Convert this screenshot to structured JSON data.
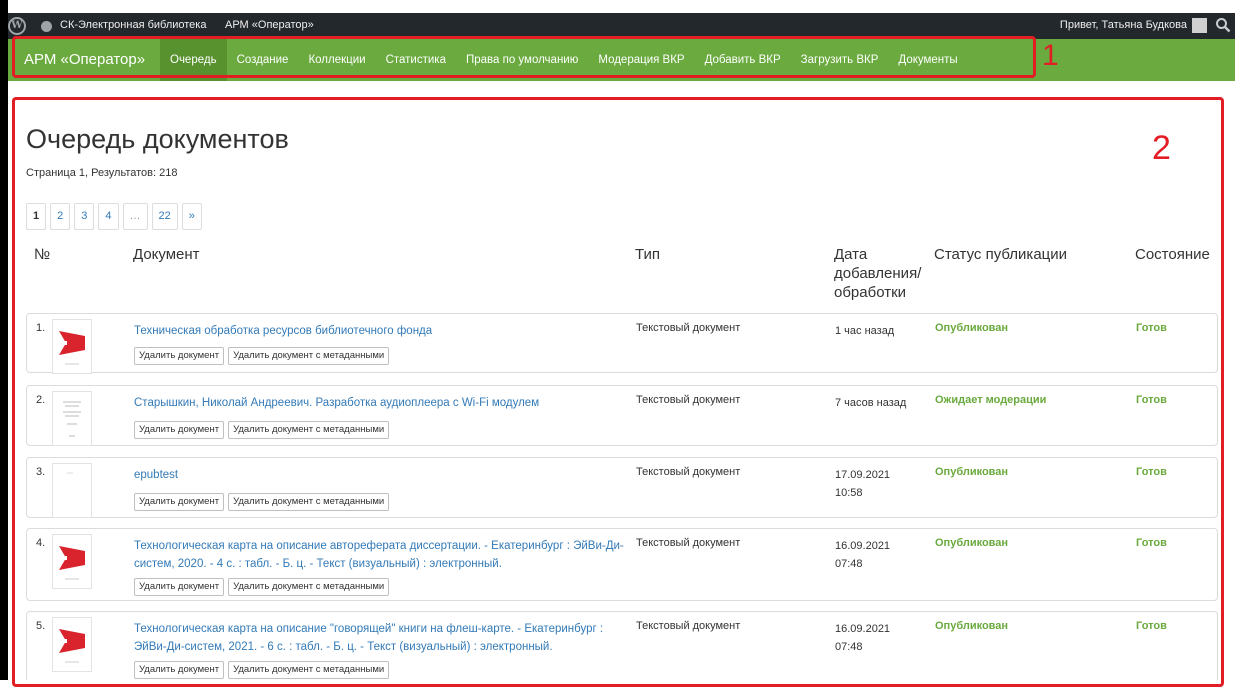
{
  "adminbar": {
    "site_name": "СК-Электронная библиотека",
    "arm_link": "АРМ «Оператор»",
    "greeting": "Привет, Татьяна Будкова"
  },
  "navbar": {
    "brand": "АРМ «Оператор»",
    "items": [
      {
        "label": "Очередь",
        "active": true
      },
      {
        "label": "Создание"
      },
      {
        "label": "Коллекции"
      },
      {
        "label": "Статистика"
      },
      {
        "label": "Права по умолчанию"
      },
      {
        "label": "Модерация ВКР"
      },
      {
        "label": "Добавить ВКР"
      },
      {
        "label": "Загрузить ВКР"
      },
      {
        "label": "Документы"
      }
    ]
  },
  "annotations": {
    "label1": "1",
    "label2": "2"
  },
  "page": {
    "title": "Очередь документов",
    "results": "Страница 1, Результатов: 218"
  },
  "pagination": {
    "pages": [
      "1",
      "2",
      "3",
      "4",
      "…",
      "22",
      "»"
    ],
    "current": "1"
  },
  "table": {
    "headers": {
      "num": "№",
      "document": "Документ",
      "type": "Тип",
      "date": "Дата добавления/ обработки",
      "status": "Статус публикации",
      "state": "Состояние"
    },
    "delete_label": "Удалить документ",
    "delete_meta_label": "Удалить документ с метаданными",
    "rows": [
      {
        "num": "1.",
        "title": "Техническая обработка ресурсов библиотечного фонда",
        "type": "Текстовый документ",
        "date": "1 час назад",
        "status": "Опубликован",
        "state": "Готов",
        "thumb": "red-cover"
      },
      {
        "num": "2.",
        "title": "Старышкин, Николай Андреевич. Разработка аудиоплеера с Wi-Fi модулем",
        "type": "Текстовый документ",
        "date": "7 часов назад",
        "status": "Ожидает модерации",
        "state": "Готов",
        "thumb": "text-page"
      },
      {
        "num": "3.",
        "title": "epubtest",
        "type": "Текстовый документ",
        "date": "17.09.2021 10:58",
        "status": "Опубликован",
        "state": "Готов",
        "thumb": "blank-page"
      },
      {
        "num": "4.",
        "title": "Технологическая карта на описание автореферата диссертации. - Екатеринбург : ЭйВи-Ди-систем, 2020. - 4 с. : табл. - Б. ц. - Текст (визуальный) : электронный.",
        "type": "Текстовый документ",
        "date": "16.09.2021 07:48",
        "status": "Опубликован",
        "state": "Готов",
        "thumb": "red-cover"
      },
      {
        "num": "5.",
        "title": "Технологическая карта на описание \"говорящей\" книги на флеш-карте. - Екатеринбург : ЭйВи-Ди-систем, 2021. - 6 с. : табл. - Б. ц. - Текст (визуальный) : электронный.",
        "type": "Текстовый документ",
        "date": "16.09.2021 07:48",
        "status": "Опубликован",
        "state": "Готов",
        "thumb": "red-cover"
      }
    ]
  },
  "colors": {
    "adminbar_bg": "#23282d",
    "navbar_bg": "#6aaa3e",
    "navbar_active_bg": "#58922f",
    "link": "#337ab7",
    "status_green": "#6aaa3e",
    "annotation_red": "#e21d24"
  }
}
